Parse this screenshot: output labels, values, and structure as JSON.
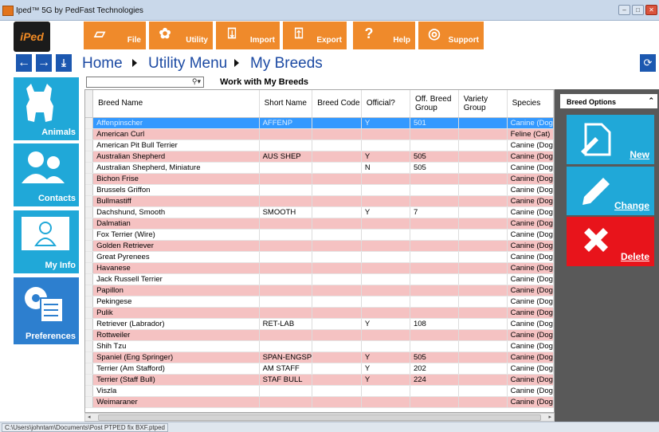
{
  "window": {
    "title": "Iped™ 5G by PedFast Technologies"
  },
  "logo": {
    "text": "iPed"
  },
  "toolbar": {
    "file": "File",
    "utility": "Utility",
    "import": "Import",
    "export": "Export",
    "help": "Help",
    "support": "Support"
  },
  "nav": {
    "home": "Home",
    "utility_menu": "Utility Menu",
    "my_breeds": "My Breeds"
  },
  "sidebar": {
    "animals": "Animals",
    "contacts": "Contacts",
    "my_info": "My Info",
    "preferences": "Preferences"
  },
  "grid": {
    "title": "Work with My Breeds",
    "search_value": "",
    "columns": [
      "Breed Name",
      "Short Name",
      "Breed Code",
      "Official?",
      "Off. Breed Group",
      "Variety Group",
      "Species"
    ],
    "rows": [
      [
        "Affenpinscher",
        "AFFENP",
        "",
        "Y",
        "501",
        "",
        "Canine (Dog"
      ],
      [
        "American Curl",
        "",
        "",
        "",
        "",
        "",
        "Feline (Cat)"
      ],
      [
        "American Pit Bull Terrier",
        "",
        "",
        "",
        "",
        "",
        "Canine (Dog"
      ],
      [
        "Australian Shepherd",
        "AUS SHEP",
        "",
        "Y",
        "505",
        "",
        "Canine (Dog"
      ],
      [
        "Australian Shepherd, Miniature",
        "",
        "",
        "N",
        "505",
        "",
        "Canine (Dog"
      ],
      [
        "Bichon Frise",
        "",
        "",
        "",
        "",
        "",
        "Canine (Dog"
      ],
      [
        "Brussels Griffon",
        "",
        "",
        "",
        "",
        "",
        "Canine (Dog"
      ],
      [
        "Bullmastiff",
        "",
        "",
        "",
        "",
        "",
        "Canine (Dog"
      ],
      [
        "Dachshund, Smooth",
        "SMOOTH",
        "",
        "Y",
        "7",
        "",
        "Canine (Dog"
      ],
      [
        "Dalmatian",
        "",
        "",
        "",
        "",
        "",
        "Canine (Dog"
      ],
      [
        "Fox Terrier (Wire)",
        "",
        "",
        "",
        "",
        "",
        "Canine (Dog"
      ],
      [
        "Golden Retriever",
        "",
        "",
        "",
        "",
        "",
        "Canine (Dog"
      ],
      [
        "Great Pyrenees",
        "",
        "",
        "",
        "",
        "",
        "Canine (Dog"
      ],
      [
        "Havanese",
        "",
        "",
        "",
        "",
        "",
        "Canine (Dog"
      ],
      [
        "Jack Russell Terrier",
        "",
        "",
        "",
        "",
        "",
        "Canine (Dog"
      ],
      [
        "Papillon",
        "",
        "",
        "",
        "",
        "",
        "Canine (Dog"
      ],
      [
        "Pekingese",
        "",
        "",
        "",
        "",
        "",
        "Canine (Dog"
      ],
      [
        "Pulik",
        "",
        "",
        "",
        "",
        "",
        "Canine (Dog"
      ],
      [
        "Retriever (Labrador)",
        "RET-LAB",
        "",
        "Y",
        "108",
        "",
        "Canine (Dog"
      ],
      [
        "Rottweiler",
        "",
        "",
        "",
        "",
        "",
        "Canine (Dog"
      ],
      [
        "Shih Tzu",
        "",
        "",
        "",
        "",
        "",
        "Canine (Dog"
      ],
      [
        "Spaniel (Eng Springer)",
        "SPAN-ENGSP",
        "",
        "Y",
        "505",
        "",
        "Canine (Dog"
      ],
      [
        "Terrier (Am Stafford)",
        "AM STAFF",
        "",
        "Y",
        "202",
        "",
        "Canine (Dog"
      ],
      [
        "Terrier (Staff Bull)",
        "STAF BULL",
        "",
        "Y",
        "224",
        "",
        "Canine (Dog"
      ],
      [
        "Viszla",
        "",
        "",
        "",
        "",
        "",
        "Canine (Dog"
      ],
      [
        "Weimaraner",
        "",
        "",
        "",
        "",
        "",
        "Canine (Dog"
      ]
    ],
    "row_styles": [
      "sel",
      "pink",
      "white",
      "pink",
      "white",
      "pink",
      "white",
      "pink",
      "white",
      "pink",
      "white",
      "pink",
      "white",
      "pink",
      "white",
      "pink",
      "white",
      "pink",
      "white",
      "pink",
      "white",
      "pink",
      "white",
      "pink",
      "white",
      "pink"
    ]
  },
  "breed_options": {
    "header": "Breed Options",
    "new": "New",
    "change": "Change",
    "delete": "Delete"
  },
  "status": {
    "path": "C:\\Users\\johntam\\Documents\\Post PTPED fix BXF.ptped"
  },
  "colors": {
    "orange": "#ef8a2b",
    "blue_tile": "#20a8d8",
    "nav_blue": "#1c58b0",
    "delete_red": "#e8141b",
    "row_pink": "#f5c2c2",
    "selected": "#3399ff"
  }
}
